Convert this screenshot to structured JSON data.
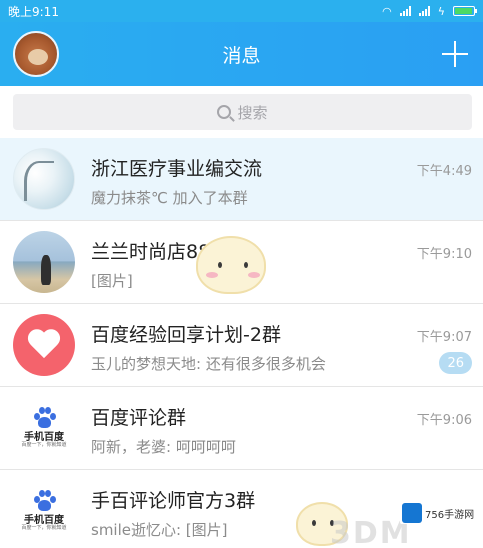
{
  "status_bar": {
    "time": "晚上9:11"
  },
  "header": {
    "title": "消息",
    "avatar_icon": "poodle-avatar",
    "add_icon": "plus-icon"
  },
  "search": {
    "placeholder": "搜索"
  },
  "conversations": [
    {
      "name": "浙江医疗事业编交流",
      "preview": "魔力抹茶℃ 加入了本群",
      "time": "下午4:49",
      "pinned": true,
      "badge": ""
    },
    {
      "name": "兰兰时尚店88",
      "preview": "[图片]",
      "time": "下午9:10",
      "pinned": false,
      "badge": ""
    },
    {
      "name": "百度经验回享计划-2群",
      "preview": "玉儿的梦想天地: 还有很多很多机会",
      "time": "下午9:07",
      "pinned": false,
      "badge": "26"
    },
    {
      "name": "百度评论群",
      "preview": "阿新，老婆: 呵呵呵呵",
      "time": "下午9:06",
      "pinned": false,
      "badge": ""
    },
    {
      "name": "手百评论师官方3群",
      "preview": "smile逝忆心: [图片]",
      "time": "",
      "pinned": false,
      "badge": ""
    }
  ],
  "baidu_logo": {
    "brand": "手机百度",
    "tagline": "百度一下，你就知道"
  },
  "watermark": {
    "text": "3DM",
    "site": "756手游网"
  },
  "colors": {
    "header": "#2aaef0",
    "badge": "#b6dcf3",
    "pinned_bg": "#eaf6fd"
  }
}
